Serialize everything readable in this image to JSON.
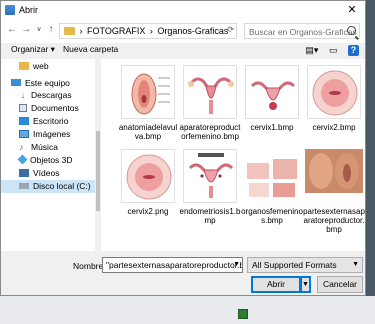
{
  "window": {
    "title": "Abrir",
    "close_glyph": "✕"
  },
  "address": {
    "breadcrumbs": [
      "FOTOGRAFIX",
      "Organos-Graficas"
    ],
    "separator": "›",
    "search_placeholder": "Buscar en Organos-Graficas"
  },
  "toolbar": {
    "organize_label": "Organizar ▾",
    "new_folder_label": "Nueva carpeta",
    "help_label": "?"
  },
  "nav": {
    "items": [
      {
        "label": "web",
        "icon": "folder-icon"
      },
      {
        "label": "Este equipo",
        "icon": "computer-icon"
      },
      {
        "label": "Descargas",
        "icon": "download-icon"
      },
      {
        "label": "Documentos",
        "icon": "documents-icon"
      },
      {
        "label": "Escritorio",
        "icon": "desktop-icon"
      },
      {
        "label": "Imágenes",
        "icon": "pictures-icon"
      },
      {
        "label": "Música",
        "icon": "music-icon"
      },
      {
        "label": "Objetos 3D",
        "icon": "objects-3d-icon"
      },
      {
        "label": "Vídeos",
        "icon": "videos-icon"
      },
      {
        "label": "Disco local (C:)",
        "icon": "drive-icon"
      }
    ]
  },
  "files": [
    {
      "name": "anatomiadelavulva.bmp"
    },
    {
      "name": "aparatoreproductorfemenino.bmp"
    },
    {
      "name": "cervix1.bmp"
    },
    {
      "name": "cervix2.bmp"
    },
    {
      "name": "cervix2.png"
    },
    {
      "name": "endometriosis1.bmp"
    },
    {
      "name": "organosfemeninos.bmp"
    },
    {
      "name": "partesexternasaparatoreproductor.bmp"
    }
  ],
  "footer": {
    "filename_label": "Nombre:",
    "filename_value": "\"partesexternasaparatoreproductor.bmp\"",
    "filter_value": "All Supported Formats",
    "open_label": "Abrir",
    "cancel_label": "Cancelar"
  }
}
